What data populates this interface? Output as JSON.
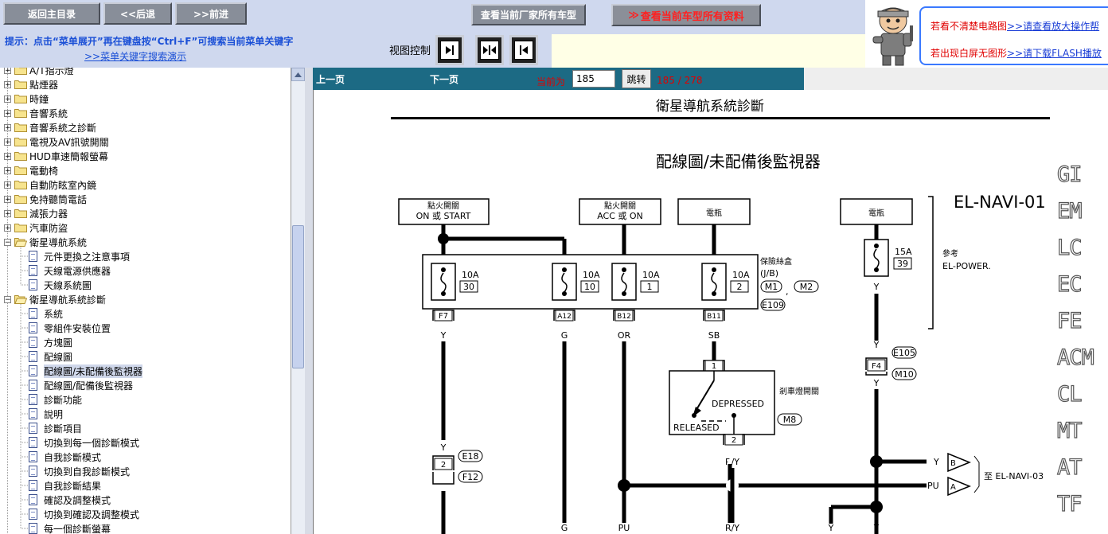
{
  "toolbar": {
    "home_label": "返回主目录",
    "back_label": "<<后退",
    "forward_label": ">>前进",
    "factory_models_label": "查看当前厂家所有车型",
    "all_data_label": "查看当前车型所有资料",
    "hint_text": "提示：点击“菜单展开”再在键盘按“Ctrl+F”可搜索当前菜单关键字",
    "demo_link": ">>菜单关键字搜索演示",
    "view_control_label": "视图控制"
  },
  "banner": {
    "line1_red": "若看不清楚电路图",
    "line1_link": ">>请查看放大操作帮",
    "line2_red": "若出现白屏无图形",
    "line2_link": ">>请下载FLASH播放"
  },
  "tree": {
    "items": [
      {
        "label": "A/T指示燈",
        "kind": "folder"
      },
      {
        "label": "點煙器",
        "kind": "folder"
      },
      {
        "label": "時鐘",
        "kind": "folder"
      },
      {
        "label": "音響系統",
        "kind": "folder"
      },
      {
        "label": "音響系統之診斷",
        "kind": "folder"
      },
      {
        "label": "電視及AV訊號開關",
        "kind": "folder"
      },
      {
        "label": "HUD車速簡報螢幕",
        "kind": "folder"
      },
      {
        "label": "電動椅",
        "kind": "folder"
      },
      {
        "label": "自動防眩室內鏡",
        "kind": "folder"
      },
      {
        "label": "免持聽筒電話",
        "kind": "folder"
      },
      {
        "label": "減張力器",
        "kind": "folder"
      },
      {
        "label": "汽車防盜",
        "kind": "folder"
      },
      {
        "label": "衛星導航系統",
        "kind": "folder-open"
      },
      {
        "label": "元件更換之注意事項",
        "kind": "doc"
      },
      {
        "label": "天線電源供應器",
        "kind": "doc"
      },
      {
        "label": "天線系統圖",
        "kind": "doc"
      },
      {
        "label": "衛星導航系統診斷",
        "kind": "folder-open"
      },
      {
        "label": "系統",
        "kind": "doc"
      },
      {
        "label": "零組件安裝位置",
        "kind": "doc"
      },
      {
        "label": "方塊圖",
        "kind": "doc"
      },
      {
        "label": "配線圖",
        "kind": "doc"
      },
      {
        "label": "配線圖/未配備後監視器",
        "kind": "doc",
        "selected": true
      },
      {
        "label": "配線圖/配備後監視器",
        "kind": "doc"
      },
      {
        "label": "診斷功能",
        "kind": "doc"
      },
      {
        "label": "說明",
        "kind": "doc"
      },
      {
        "label": "診斷項目",
        "kind": "doc"
      },
      {
        "label": "切換到每一個診斷模式",
        "kind": "doc"
      },
      {
        "label": "自我診斷模式",
        "kind": "doc"
      },
      {
        "label": "切換到自我診斷模式",
        "kind": "doc"
      },
      {
        "label": "自我診斷結果",
        "kind": "doc"
      },
      {
        "label": "確認及調整模式",
        "kind": "doc"
      },
      {
        "label": "切換到確認及調整模式",
        "kind": "doc"
      },
      {
        "label": "每一個診斷螢幕",
        "kind": "doc"
      }
    ]
  },
  "pager": {
    "prev_label": "上一页",
    "next_label": "下一页",
    "current_label": "当前为",
    "current_value": "185",
    "jump_label": "跳转",
    "count_text": "185 / 278"
  },
  "document": {
    "title": "衛星導航系統診斷",
    "diagram_title": "配線圖/未配備後監視器",
    "diagram_code": "EL-NAVI-01",
    "side_tabs": [
      "GI",
      "EM",
      "LC",
      "EC",
      "FE",
      "ACM",
      "CL",
      "MT",
      "AT",
      "TF"
    ],
    "labels": {
      "ign1": "點火開關",
      "ign1_sub": "ON 或 START",
      "ign2": "點火開關",
      "ign2_sub": "ACC 或 ON",
      "bat1": "電瓶",
      "bat2": "電瓶",
      "fuse_block": "保險絲盒",
      "jb": "(J/B)",
      "m1": "M1",
      "m2": "M2",
      "e109": "E109",
      "ref": "參考",
      "ref_power": "EL-POWER.",
      "fuse_30_amp": "10A",
      "fuse_30_no": "30",
      "fuse_10_amp": "10A",
      "fuse_10_no": "10",
      "fuse_1_amp": "10A",
      "fuse_1_no": "1",
      "fuse_2_amp": "10A",
      "fuse_2_no": "2",
      "fuse_39_amp": "15A",
      "fuse_39_no": "39",
      "f7": "F7",
      "a12": "A12",
      "b12": "B12",
      "b11": "B11",
      "w_y1": "Y",
      "w_g": "G",
      "w_or": "OR",
      "w_sb": "SB",
      "y_fuse39": "Y",
      "y_e105": "Y",
      "y_f4": "Y",
      "e105": "E105",
      "f4": "F4",
      "m10": "M10",
      "brake_sw": "剎車燈開關",
      "depressed": "DEPRESSED",
      "released": "RELEASED",
      "m8": "M8",
      "pin1": "1",
      "pin2_sw": "2",
      "w_ry": "R/Y",
      "e18": "E18",
      "f12": "F12",
      "pin2_conn": "2",
      "w_y_e18": "Y",
      "out_b": "B",
      "out_a": "A",
      "w_y_out": "Y",
      "w_pu_out": "PU",
      "to_navi": "至 EL-NAVI-03",
      "bot_g": "G",
      "bot_pu": "PU",
      "bot_ry": "R/Y",
      "bot_y1": "Y",
      "bot_y2": "Y"
    }
  }
}
